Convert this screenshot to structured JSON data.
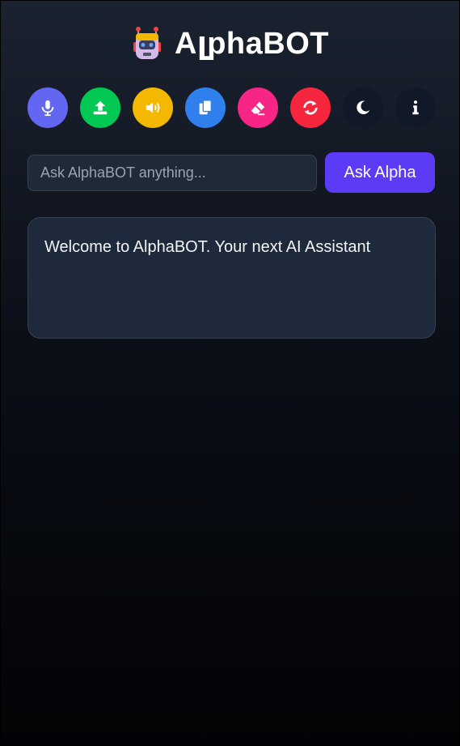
{
  "app": {
    "title": "AլphaBOT",
    "logo_icon": "robot-icon"
  },
  "toolbar": {
    "buttons": [
      {
        "name": "microphone",
        "icon": "microphone-icon",
        "color": "#6366f1"
      },
      {
        "name": "upload",
        "icon": "upload-icon",
        "color": "#00c853"
      },
      {
        "name": "speaker",
        "icon": "speaker-icon",
        "color": "#f5b800"
      },
      {
        "name": "copy",
        "icon": "copy-icon",
        "color": "#2f80ed"
      },
      {
        "name": "eraser",
        "icon": "eraser-icon",
        "color": "#f72585"
      },
      {
        "name": "refresh",
        "icon": "refresh-icon",
        "color": "#f5263d"
      },
      {
        "name": "theme",
        "icon": "moon-icon",
        "color": "#111827"
      },
      {
        "name": "info",
        "icon": "info-icon",
        "color": "#111827"
      }
    ]
  },
  "ask": {
    "placeholder": "Ask AlphaBOT anything...",
    "value": "",
    "button_label": "Ask Alpha"
  },
  "response": {
    "text": "Welcome to AlphaBOT. Your next AI Assistant"
  }
}
